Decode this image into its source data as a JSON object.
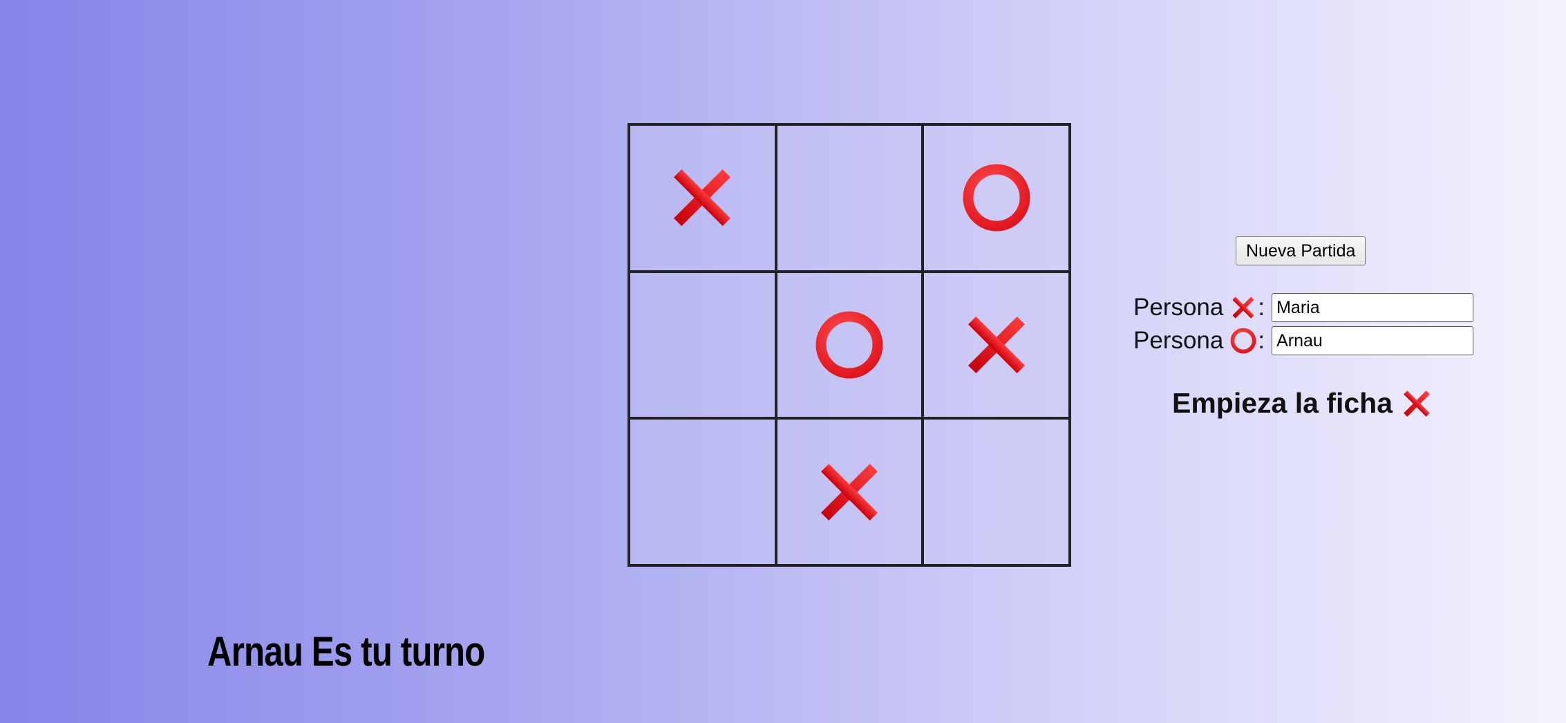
{
  "board": {
    "cells": [
      "X",
      "",
      "O",
      "",
      "O",
      "X",
      "",
      "X",
      ""
    ]
  },
  "controls": {
    "new_game_label": "Nueva Partida",
    "player_label": "Persona",
    "colon": ":",
    "player_x_name": "Maria",
    "player_o_name": "Arnau",
    "starts_label": "Empieza la ficha",
    "starts_symbol": "X"
  },
  "status": {
    "turn_text": "Arnau Es tu turno"
  },
  "icons": {
    "x": "cross-mark-icon",
    "o": "heavy-circle-icon"
  },
  "colors": {
    "mark_red": "#e0131d",
    "grid_line": "#222222",
    "bg_left": "#8584e9",
    "bg_right": "#f4f3fd"
  }
}
